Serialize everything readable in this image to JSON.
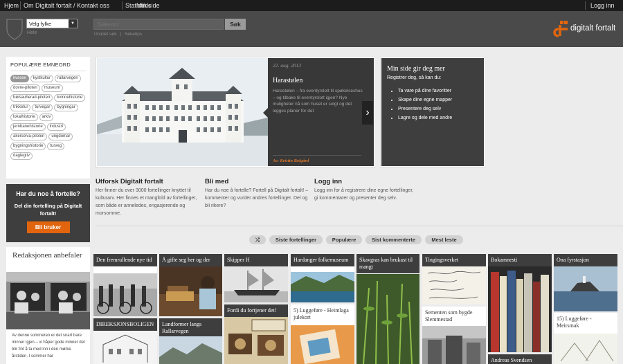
{
  "topnav": {
    "home": "Hjem",
    "about": "Om Digitalt fortalt / Kontakt oss",
    "stats": "Statistikk",
    "mypage": "Min side",
    "login": "Logg inn"
  },
  "header": {
    "county_select": "Velg fylke",
    "county_hint": "Hele",
    "search_placeholder": "Søkeord",
    "search_button": "Søk",
    "search_link_advanced": "Utvidet søk",
    "search_link_separator": "|",
    "search_link_help": "Søketips",
    "logo_text": "digitalt fortalt"
  },
  "tags_panel": {
    "title": "POPULÆRE EMNEORD",
    "tags": [
      "kvesse",
      "kystkultur",
      "rallarvegen",
      "dovre-piloten",
      "museum",
      "bø/sauherad-piloten",
      "kvinnehistorie",
      "trikketur",
      "turvegar",
      "bygningar",
      "lokalhistorie",
      "arkiv",
      "jernbanehistorie",
      "industri",
      "akerselva-piloten",
      "ungdomar",
      "bygningshistorie",
      "turveg",
      "dagleglív"
    ]
  },
  "cta": {
    "title": "Har du noe å fortelle?",
    "text": "Del din fortelling på Digitalt fortalt!",
    "button": "Bli bruker"
  },
  "recommend": {
    "title": "Redaksjonen anbefaler",
    "text": "Av denne sommeren er det snart bare minner igjen – vi håper gode minner det blir fint å ta med inn i den mørke årstiden. I sommer har"
  },
  "carousel": {
    "date": "22. aug. 2013",
    "title": "Harastølen",
    "body": "Harastølen – fra eventyrslott til spøkelseshus – og tilbake til eventyrslott igjen? Nye muligheter nå som huset er solgt og det legges planer for det",
    "author": "Av: Kristin Bolgård",
    "next": "›"
  },
  "minside": {
    "title": "Min side gir deg mer",
    "sub": "Registrer deg, så kan du:",
    "items": [
      "Ta vare på dine favoritter",
      "Skape dine egne mapper",
      "Presentere deg selv",
      "Lagre og dele med andre"
    ]
  },
  "info": [
    {
      "title": "Utforsk Digitalt fortalt",
      "body": "Her finner du over 3000 fortellinger knyttet til kulturarv. Her finnes et mangfold av fortellinger, som både er anneledes, engasjerende og morsomme."
    },
    {
      "title": "Bli med",
      "body": "Har du noe å fortelle? Fortell på Digitalt fortalt! – kommenter og vurder andres fortellinger. Del og bli rikere?"
    },
    {
      "title": "Logg inn",
      "body": "Logg inn for å registrere dine egne fortellinger, gi kommentarer og presenter deg selv."
    }
  ],
  "filters": {
    "shuffle": "⤮",
    "latest": "Siste fortellinger",
    "popular": "Populære",
    "most_commented": "Sist kommenterte",
    "most_read": "Mest leste"
  },
  "cards": [
    "Den fremrullende nye tid",
    "Å gifte seg her og der",
    "Skipper H",
    "Hardanger folkemuseum",
    "Skavgras kan brukast til mangt",
    "Tingingsverket",
    "Bokamnesti",
    "Ona fyrstasjon",
    "DIREKSJONSBOLIGEN",
    "Landformer langs Rallarvegen",
    "Fordi du fortjener det!",
    "5) Luggeføre - Heimlaga julekort",
    "Sementen som bygde Slemmestad",
    "15) Luggeføre - Meirsmak",
    "Andreas Svendsen"
  ],
  "colors": {
    "accent": "#e2650e",
    "dark": "#3e3e3e",
    "nav": "#1c1c1c",
    "header": "#4a4a4a"
  }
}
